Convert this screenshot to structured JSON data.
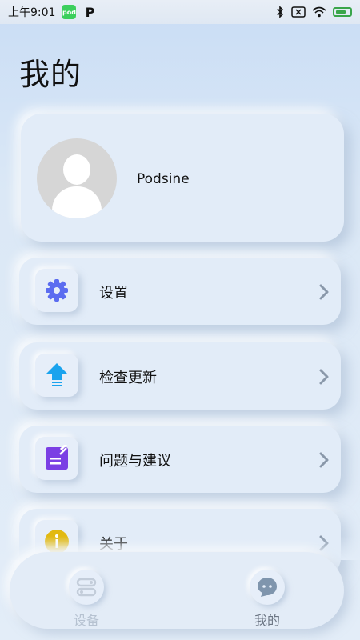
{
  "status_bar": {
    "time": "上午9:01",
    "app_icons": [
      "green-app-icon",
      "p-app-icon"
    ],
    "system_icons": [
      "bluetooth-icon",
      "sim-icon",
      "wifi-icon",
      "battery-icon"
    ]
  },
  "page": {
    "title": "我的"
  },
  "profile": {
    "username": "Podsine",
    "avatar_icon": "avatar-placeholder-icon"
  },
  "menu": {
    "items": [
      {
        "label": "设置",
        "icon": "gear-icon",
        "icon_color": "#5b6cf0"
      },
      {
        "label": "检查更新",
        "icon": "upload-arrow-icon",
        "icon_color": "#1aa3ee"
      },
      {
        "label": "问题与建议",
        "icon": "feedback-note-icon",
        "icon_color": "#7b3fe4"
      },
      {
        "label": "关于",
        "icon": "info-icon",
        "icon_color": "#e2b911"
      }
    ]
  },
  "tabbar": {
    "tabs": [
      {
        "label": "设备",
        "icon": "devices-toggle-icon",
        "active": false
      },
      {
        "label": "我的",
        "icon": "chat-bubble-icon",
        "active": true
      }
    ]
  },
  "colors": {
    "background": "#dbe8f6",
    "card": "#e2ecf8",
    "chevron": "#8a98aa"
  }
}
